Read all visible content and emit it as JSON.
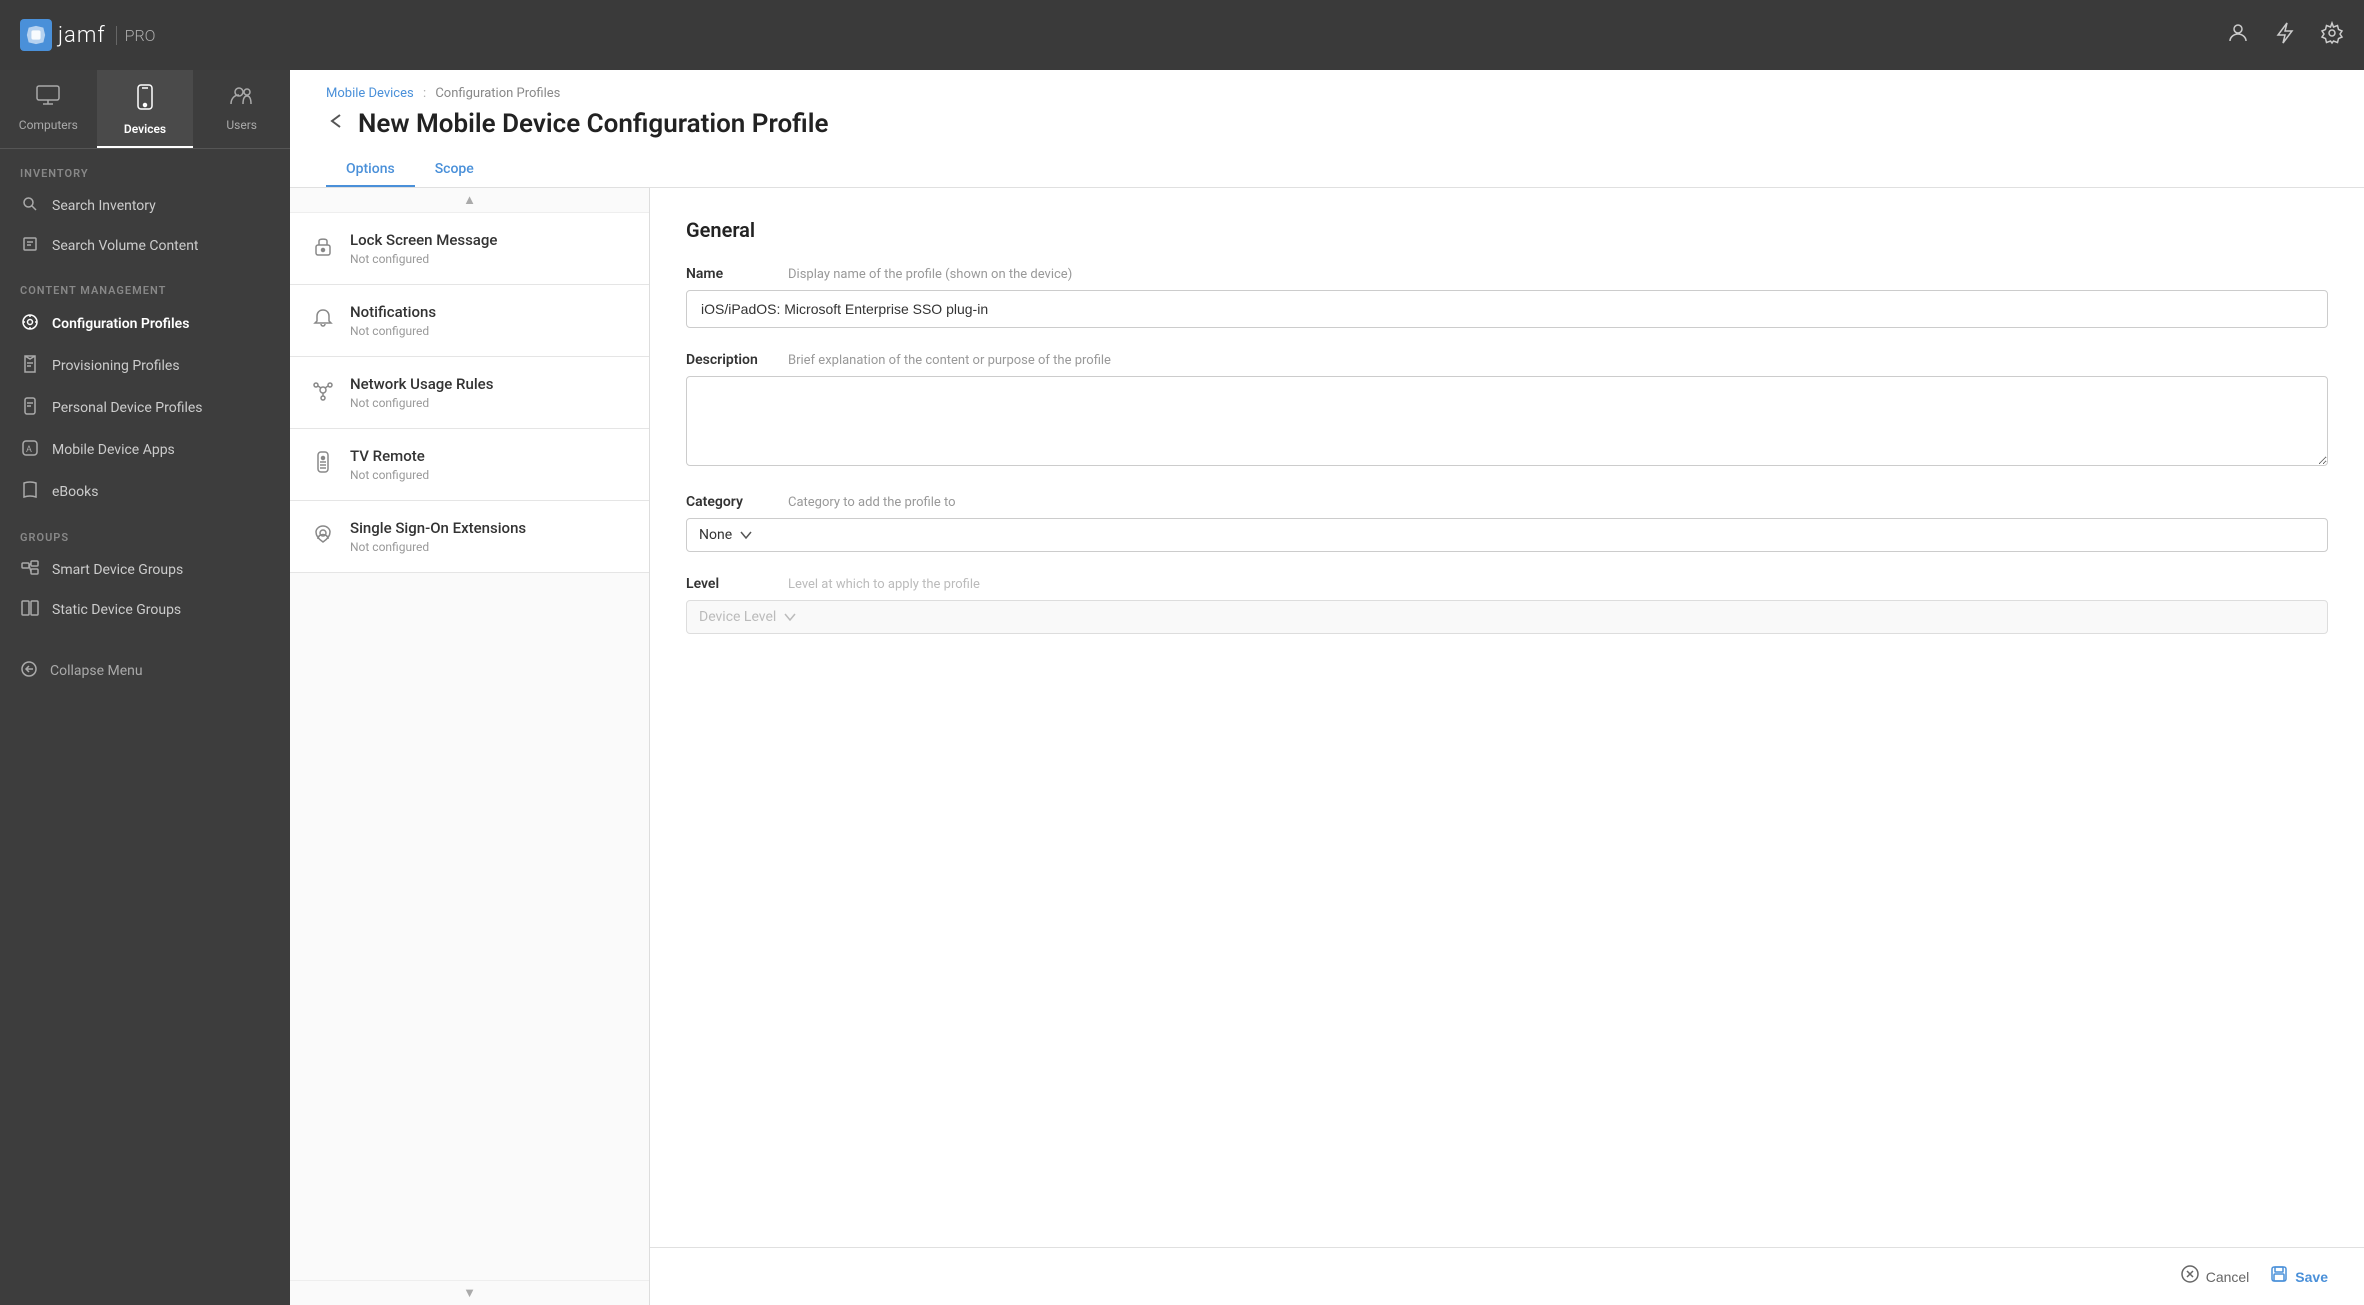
{
  "topNav": {
    "logoText": "jamf",
    "proText": "PRO",
    "icons": {
      "user": "👤",
      "lightning": "⚡",
      "gear": "⚙"
    }
  },
  "sidebarTabs": [
    {
      "id": "computers",
      "label": "Computers",
      "icon": "🖥"
    },
    {
      "id": "devices",
      "label": "Devices",
      "icon": "📱",
      "active": true
    },
    {
      "id": "users",
      "label": "Users",
      "icon": "👥"
    }
  ],
  "sidebar": {
    "sections": [
      {
        "label": "INVENTORY",
        "items": [
          {
            "id": "search-inventory",
            "label": "Search Inventory",
            "icon": "🔍"
          },
          {
            "id": "search-volume",
            "label": "Search Volume Content",
            "icon": "🔲"
          }
        ]
      },
      {
        "label": "CONTENT MANAGEMENT",
        "items": [
          {
            "id": "config-profiles",
            "label": "Configuration Profiles",
            "icon": "⚙",
            "active": true
          },
          {
            "id": "provisioning",
            "label": "Provisioning Profiles",
            "icon": "📄"
          },
          {
            "id": "personal-device",
            "label": "Personal Device Profiles",
            "icon": "📋"
          },
          {
            "id": "mobile-apps",
            "label": "Mobile Device Apps",
            "icon": "🅰"
          },
          {
            "id": "ebooks",
            "label": "eBooks",
            "icon": "📖"
          }
        ]
      },
      {
        "label": "GROUPS",
        "items": [
          {
            "id": "smart-device-groups",
            "label": "Smart Device Groups",
            "icon": "🖥"
          },
          {
            "id": "static-device-groups",
            "label": "Static Device Groups",
            "icon": "🖥"
          }
        ]
      }
    ],
    "collapseLabel": "Collapse Menu"
  },
  "breadcrumb": {
    "parent": "Mobile Devices",
    "separator": ":",
    "current": "Configuration Profiles"
  },
  "pageTitle": "New Mobile Device Configuration Profile",
  "tabs": [
    {
      "id": "options",
      "label": "Options",
      "active": true
    },
    {
      "id": "scope",
      "label": "Scope"
    }
  ],
  "profileSections": [
    {
      "id": "lock-screen",
      "name": "Lock Screen Message",
      "status": "Not configured",
      "icon": "🔒"
    },
    {
      "id": "notifications",
      "name": "Notifications",
      "status": "Not configured",
      "icon": "🔔"
    },
    {
      "id": "network-usage",
      "name": "Network Usage Rules",
      "status": "Not configured",
      "icon": "🔀"
    },
    {
      "id": "tv-remote",
      "name": "TV Remote",
      "status": "Not configured",
      "icon": "🏷"
    },
    {
      "id": "sso-extensions",
      "name": "Single Sign-On Extensions",
      "status": "Not configured",
      "icon": "☁"
    }
  ],
  "form": {
    "sectionTitle": "General",
    "nameLabel": "Name",
    "nameHint": "Display name of the profile (shown on the device)",
    "nameValue": "iOS/iPadOS: Microsoft Enterprise SSO plug-in",
    "descriptionLabel": "Description",
    "descriptionHint": "Brief explanation of the content or purpose of the profile",
    "descriptionValue": "",
    "descriptionPlaceholder": "",
    "categoryLabel": "Category",
    "categoryHint": "Category to add the profile to",
    "categoryValue": "None",
    "levelLabel": "Level",
    "levelHint": "Level at which to apply the profile",
    "levelValue": "Device Level",
    "levelDisabled": true
  },
  "actions": {
    "cancelLabel": "Cancel",
    "saveLabel": "Save"
  }
}
